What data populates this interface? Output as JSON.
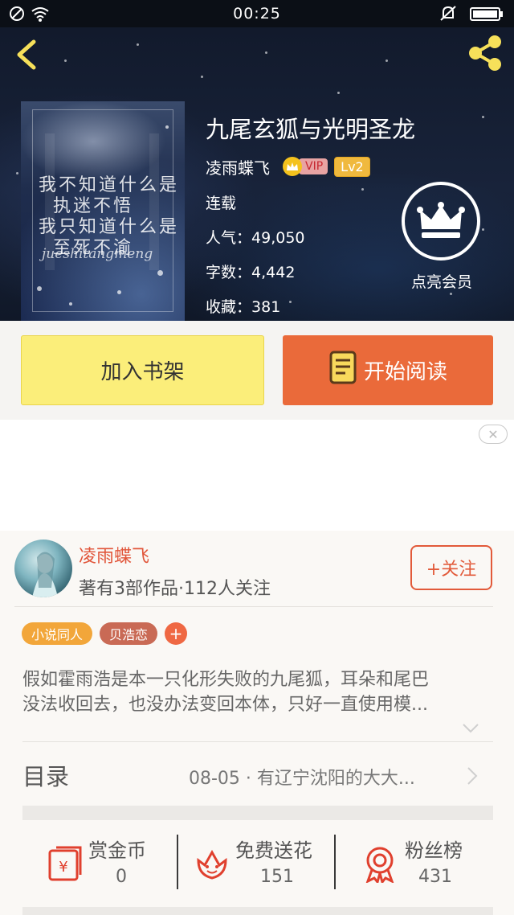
{
  "status_bar": {
    "time": "00:25"
  },
  "book": {
    "title": "九尾玄狐与光明圣龙",
    "author": "凌雨蝶飞",
    "vip_label": "VIP",
    "level": "Lv2",
    "status": "连载",
    "popularity_label": "人气：",
    "popularity": "49,050",
    "words_label": "字数：",
    "words": "4,442",
    "favorites_label": "收藏：",
    "favorites": "381"
  },
  "member": {
    "label": "点亮会员"
  },
  "actions": {
    "add_to_shelf": "加入书架",
    "start_reading": "开始阅读"
  },
  "author_card": {
    "name": "凌雨蝶飞",
    "stats": "著有3部作品·112人关注",
    "follow": "+关注"
  },
  "tags": [
    {
      "label": "小说同人",
      "color": "#f2a63a"
    },
    {
      "label": "贝浩恋",
      "color": "#c96a55"
    }
  ],
  "tag_add": "+",
  "synopsis": {
    "line1": "假如霍雨浩是本一只化形失败的九尾狐，耳朵和尾巴",
    "line2": "没法收回去，也没办法变回本体，只好一直使用模..."
  },
  "toc": {
    "label": "目录",
    "latest": "08-05 · 有辽宁沈阳的大大..."
  },
  "stats": [
    {
      "label": "赏金币",
      "value": "0",
      "icon": "red-envelope-icon"
    },
    {
      "label": "免费送花",
      "value": "151",
      "icon": "flower-icon"
    },
    {
      "label": "粉丝榜",
      "value": "431",
      "icon": "medal-icon"
    }
  ],
  "colors": {
    "accent": "#ea6a3a",
    "shelf_button": "#fbee7a",
    "author_name": "#e1553a"
  }
}
